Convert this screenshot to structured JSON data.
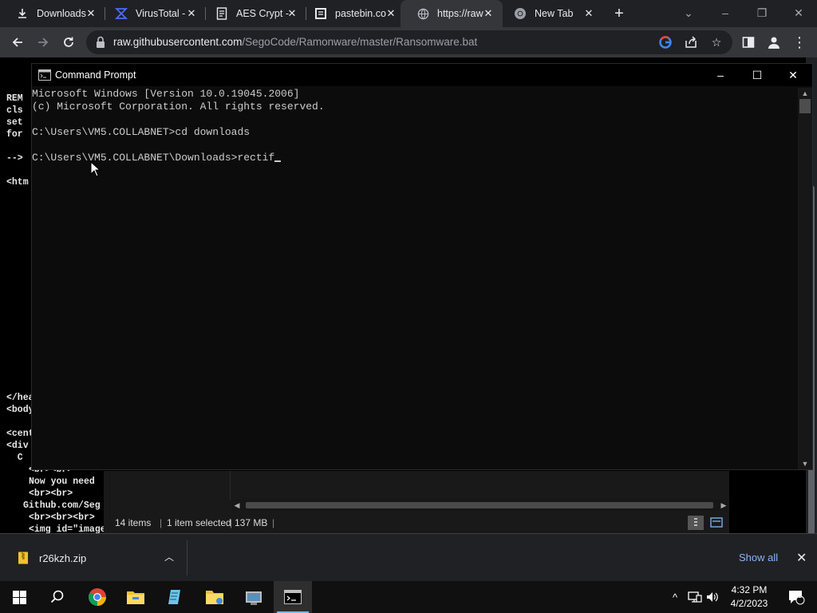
{
  "browser": {
    "tabs": [
      {
        "title": "Downloads",
        "icon": "download-icon"
      },
      {
        "title": "VirusTotal -",
        "icon": "virustotal-icon"
      },
      {
        "title": "AES Crypt -",
        "icon": "document-icon"
      },
      {
        "title": "pastebin.co",
        "icon": "pastebin-icon"
      },
      {
        "title": "https://raw",
        "icon": "globe-icon"
      },
      {
        "title": "New Tab",
        "icon": "chrome-icon"
      }
    ],
    "url_host": "raw.githubusercontent.com",
    "url_path": "/SegoCode/Ramonware/master/Ransomware.bat"
  },
  "page_text": {
    "lines": [
      "REM",
      "cls",
      "set",
      "for",
      "-->",
      "<htm",
      "</hea",
      "<body",
      "<cent",
      "<div",
      "  C",
      "<br><br>",
      "Now you need",
      "<br><br>",
      "Github.com/Seg",
      "<br><br><br>",
      "<img id=\"image"
    ]
  },
  "cmd": {
    "title": "Command Prompt",
    "lines": [
      "Microsoft Windows [Version 10.0.19045.2006]",
      "(c) Microsoft Corporation. All rights reserved.",
      "",
      "C:\\Users\\VM5.COLLABNET>cd downloads",
      "",
      "C:\\Users\\VM5.COLLABNET\\Downloads>rectif"
    ]
  },
  "explorer": {
    "items_count": "14 items",
    "selected": "1 item selected",
    "size": "137 MB"
  },
  "downloads_bar": {
    "file": "r26kzh.zip",
    "show_all": "Show all"
  },
  "taskbar": {
    "time": "4:32 PM",
    "date": "4/2/2023",
    "notification_count": "1"
  },
  "colors": {
    "chrome_dark": "#202124",
    "chrome_tab_active": "#35363a",
    "link_blue": "#8ab4f8",
    "cmd_text": "#cccccc"
  }
}
